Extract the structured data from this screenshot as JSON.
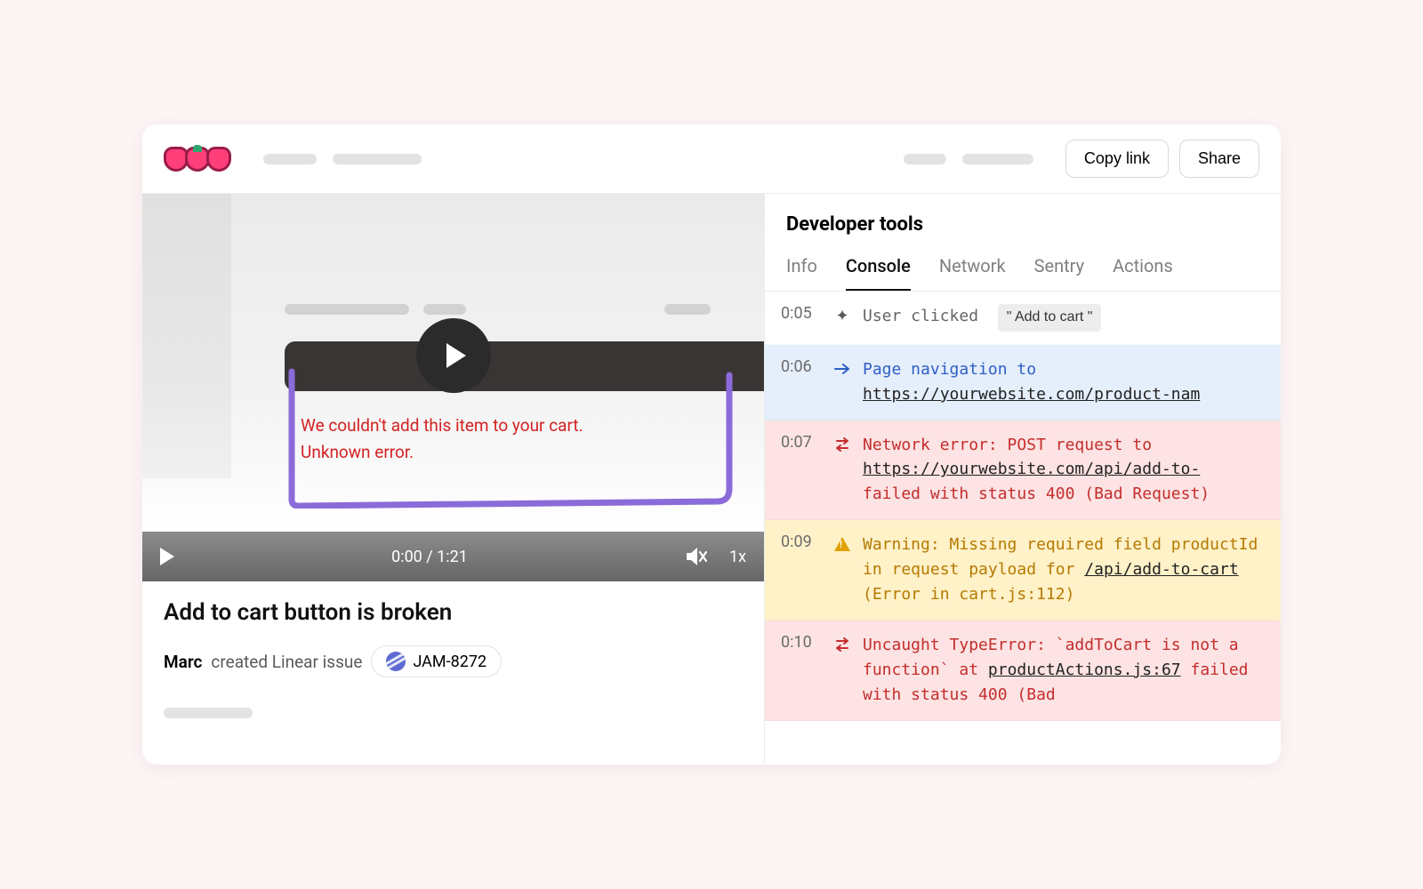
{
  "topbar": {
    "copy_link": "Copy link",
    "share": "Share"
  },
  "video": {
    "error_line1": "We couldn't add this item to your cart.",
    "error_line2": "Unknown error.",
    "time": "0:00 / 1:21",
    "speed": "1x"
  },
  "issue": {
    "title": "Add to cart button is broken",
    "author": "Marc",
    "created_text": "created Linear issue",
    "linear_id": "JAM-8272"
  },
  "devtools": {
    "title": "Developer tools",
    "tabs": {
      "info": "Info",
      "console": "Console",
      "network": "Network",
      "sentry": "Sentry",
      "actions": "Actions"
    },
    "logs": {
      "r0": {
        "time": "0:05",
        "text": "User clicked",
        "pill": "\" Add to cart \""
      },
      "r1": {
        "time": "0:06",
        "text": "Page navigation to",
        "url": "https://yourwebsite.com/product-nam"
      },
      "r2": {
        "time": "0:07",
        "text1": "Network error: POST request to",
        "url": "https://yourwebsite.com/api/add-to-",
        "text2": "failed with status 400 (Bad Request)"
      },
      "r3": {
        "time": "0:09",
        "text1": "Warning: Missing required field productId in request payload for",
        "url": "/api/add-to-cart",
        "text2": "(Error in cart.js:112)"
      },
      "r4": {
        "time": "0:10",
        "text1": "Uncaught TypeError: `addToCart is not a function` at",
        "url": "productActions.js:67",
        "text2": "failed with status 400 (Bad"
      }
    }
  }
}
